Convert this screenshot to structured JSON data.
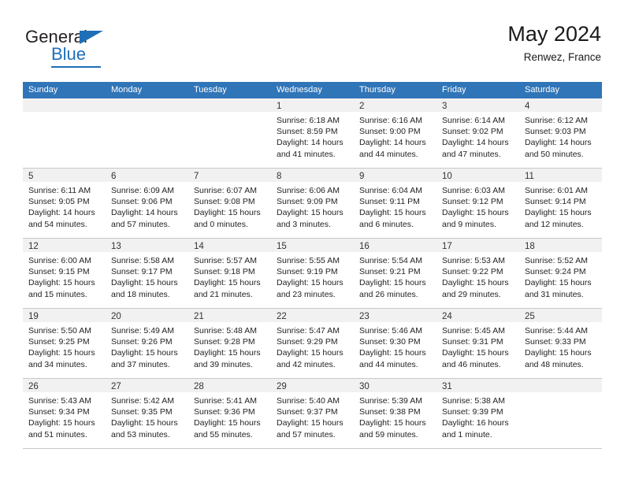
{
  "brand": {
    "name_top": "General",
    "name_bottom": "Blue",
    "accent_color": "#1f6fb8",
    "text_color": "#231f20"
  },
  "header": {
    "title": "May 2024",
    "subtitle": "Renwez, France"
  },
  "theme": {
    "header_row_bg": "#3075b8",
    "header_row_text": "#ffffff",
    "day_band_bg": "#f1f1f1",
    "grid_line": "#c8c8c8"
  },
  "weekdays": [
    "Sunday",
    "Monday",
    "Tuesday",
    "Wednesday",
    "Thursday",
    "Friday",
    "Saturday"
  ],
  "weeks": [
    [
      {
        "day": "",
        "lines": []
      },
      {
        "day": "",
        "lines": []
      },
      {
        "day": "",
        "lines": []
      },
      {
        "day": "1",
        "lines": [
          "Sunrise: 6:18 AM",
          "Sunset: 8:59 PM",
          "Daylight: 14 hours",
          "and 41 minutes."
        ]
      },
      {
        "day": "2",
        "lines": [
          "Sunrise: 6:16 AM",
          "Sunset: 9:00 PM",
          "Daylight: 14 hours",
          "and 44 minutes."
        ]
      },
      {
        "day": "3",
        "lines": [
          "Sunrise: 6:14 AM",
          "Sunset: 9:02 PM",
          "Daylight: 14 hours",
          "and 47 minutes."
        ]
      },
      {
        "day": "4",
        "lines": [
          "Sunrise: 6:12 AM",
          "Sunset: 9:03 PM",
          "Daylight: 14 hours",
          "and 50 minutes."
        ]
      }
    ],
    [
      {
        "day": "5",
        "lines": [
          "Sunrise: 6:11 AM",
          "Sunset: 9:05 PM",
          "Daylight: 14 hours",
          "and 54 minutes."
        ]
      },
      {
        "day": "6",
        "lines": [
          "Sunrise: 6:09 AM",
          "Sunset: 9:06 PM",
          "Daylight: 14 hours",
          "and 57 minutes."
        ]
      },
      {
        "day": "7",
        "lines": [
          "Sunrise: 6:07 AM",
          "Sunset: 9:08 PM",
          "Daylight: 15 hours",
          "and 0 minutes."
        ]
      },
      {
        "day": "8",
        "lines": [
          "Sunrise: 6:06 AM",
          "Sunset: 9:09 PM",
          "Daylight: 15 hours",
          "and 3 minutes."
        ]
      },
      {
        "day": "9",
        "lines": [
          "Sunrise: 6:04 AM",
          "Sunset: 9:11 PM",
          "Daylight: 15 hours",
          "and 6 minutes."
        ]
      },
      {
        "day": "10",
        "lines": [
          "Sunrise: 6:03 AM",
          "Sunset: 9:12 PM",
          "Daylight: 15 hours",
          "and 9 minutes."
        ]
      },
      {
        "day": "11",
        "lines": [
          "Sunrise: 6:01 AM",
          "Sunset: 9:14 PM",
          "Daylight: 15 hours",
          "and 12 minutes."
        ]
      }
    ],
    [
      {
        "day": "12",
        "lines": [
          "Sunrise: 6:00 AM",
          "Sunset: 9:15 PM",
          "Daylight: 15 hours",
          "and 15 minutes."
        ]
      },
      {
        "day": "13",
        "lines": [
          "Sunrise: 5:58 AM",
          "Sunset: 9:17 PM",
          "Daylight: 15 hours",
          "and 18 minutes."
        ]
      },
      {
        "day": "14",
        "lines": [
          "Sunrise: 5:57 AM",
          "Sunset: 9:18 PM",
          "Daylight: 15 hours",
          "and 21 minutes."
        ]
      },
      {
        "day": "15",
        "lines": [
          "Sunrise: 5:55 AM",
          "Sunset: 9:19 PM",
          "Daylight: 15 hours",
          "and 23 minutes."
        ]
      },
      {
        "day": "16",
        "lines": [
          "Sunrise: 5:54 AM",
          "Sunset: 9:21 PM",
          "Daylight: 15 hours",
          "and 26 minutes."
        ]
      },
      {
        "day": "17",
        "lines": [
          "Sunrise: 5:53 AM",
          "Sunset: 9:22 PM",
          "Daylight: 15 hours",
          "and 29 minutes."
        ]
      },
      {
        "day": "18",
        "lines": [
          "Sunrise: 5:52 AM",
          "Sunset: 9:24 PM",
          "Daylight: 15 hours",
          "and 31 minutes."
        ]
      }
    ],
    [
      {
        "day": "19",
        "lines": [
          "Sunrise: 5:50 AM",
          "Sunset: 9:25 PM",
          "Daylight: 15 hours",
          "and 34 minutes."
        ]
      },
      {
        "day": "20",
        "lines": [
          "Sunrise: 5:49 AM",
          "Sunset: 9:26 PM",
          "Daylight: 15 hours",
          "and 37 minutes."
        ]
      },
      {
        "day": "21",
        "lines": [
          "Sunrise: 5:48 AM",
          "Sunset: 9:28 PM",
          "Daylight: 15 hours",
          "and 39 minutes."
        ]
      },
      {
        "day": "22",
        "lines": [
          "Sunrise: 5:47 AM",
          "Sunset: 9:29 PM",
          "Daylight: 15 hours",
          "and 42 minutes."
        ]
      },
      {
        "day": "23",
        "lines": [
          "Sunrise: 5:46 AM",
          "Sunset: 9:30 PM",
          "Daylight: 15 hours",
          "and 44 minutes."
        ]
      },
      {
        "day": "24",
        "lines": [
          "Sunrise: 5:45 AM",
          "Sunset: 9:31 PM",
          "Daylight: 15 hours",
          "and 46 minutes."
        ]
      },
      {
        "day": "25",
        "lines": [
          "Sunrise: 5:44 AM",
          "Sunset: 9:33 PM",
          "Daylight: 15 hours",
          "and 48 minutes."
        ]
      }
    ],
    [
      {
        "day": "26",
        "lines": [
          "Sunrise: 5:43 AM",
          "Sunset: 9:34 PM",
          "Daylight: 15 hours",
          "and 51 minutes."
        ]
      },
      {
        "day": "27",
        "lines": [
          "Sunrise: 5:42 AM",
          "Sunset: 9:35 PM",
          "Daylight: 15 hours",
          "and 53 minutes."
        ]
      },
      {
        "day": "28",
        "lines": [
          "Sunrise: 5:41 AM",
          "Sunset: 9:36 PM",
          "Daylight: 15 hours",
          "and 55 minutes."
        ]
      },
      {
        "day": "29",
        "lines": [
          "Sunrise: 5:40 AM",
          "Sunset: 9:37 PM",
          "Daylight: 15 hours",
          "and 57 minutes."
        ]
      },
      {
        "day": "30",
        "lines": [
          "Sunrise: 5:39 AM",
          "Sunset: 9:38 PM",
          "Daylight: 15 hours",
          "and 59 minutes."
        ]
      },
      {
        "day": "31",
        "lines": [
          "Sunrise: 5:38 AM",
          "Sunset: 9:39 PM",
          "Daylight: 16 hours",
          "and 1 minute."
        ]
      },
      {
        "day": "",
        "lines": []
      }
    ]
  ]
}
